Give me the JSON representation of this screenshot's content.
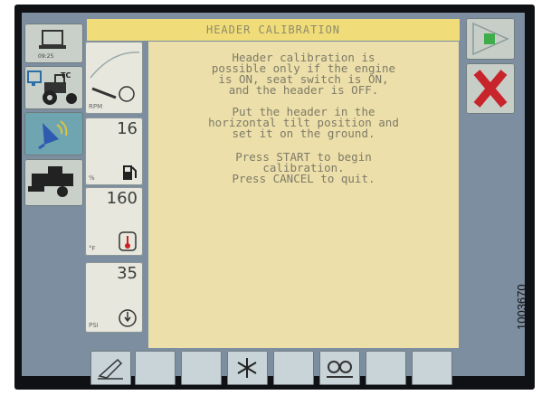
{
  "title": "HEADER CALIBRATION",
  "message": {
    "paragraph1": "Header calibration is\npossible only if the engine\nis ON, seat switch is ON,\nand the header is OFF.",
    "paragraph2": "Put the header in the\nhorizontal tilt position and\nset it on the ground.",
    "paragraph3": "Press START to begin\ncalibration.\nPress CANCEL to quit."
  },
  "left_panel": {
    "time": "09:25",
    "tc_label": "TC"
  },
  "gauges": [
    {
      "name": "engine-rpm",
      "value": "",
      "unit": "RPM"
    },
    {
      "name": "fuel",
      "value": "16",
      "unit": "%"
    },
    {
      "name": "coolant-temp",
      "value": "160",
      "unit": "°F"
    },
    {
      "name": "oil-pressure",
      "value": "35",
      "unit": "PSI"
    }
  ],
  "reference_id": "1003670",
  "colors": {
    "title_bg": "#f0dd7a",
    "message_bg": "#ecdfa9",
    "start_green": "#3fae4a",
    "cancel_red": "#c8242b"
  },
  "icons": {
    "start": "play-triangle-icon",
    "cancel": "x-icon",
    "softkey1": "header-tilt-icon",
    "softkey4": "asterisk-icon",
    "softkey6": "wheels-icon"
  }
}
